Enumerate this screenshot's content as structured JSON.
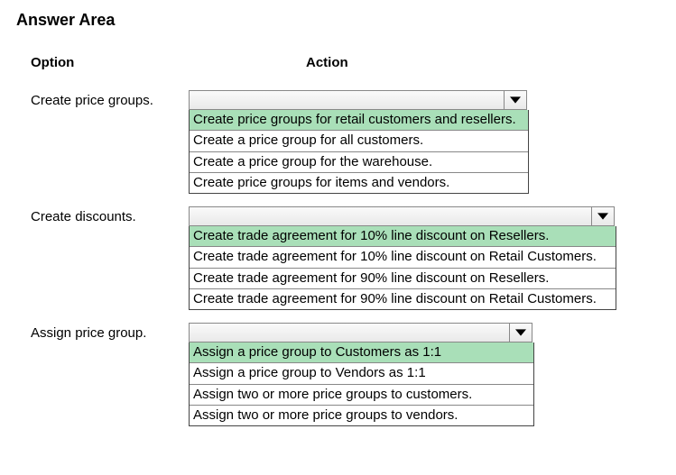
{
  "title": "Answer Area",
  "headers": {
    "option": "Option",
    "action": "Action"
  },
  "rows": [
    {
      "label": "Create price groups.",
      "options": [
        "Create price groups for retail customers and resellers.",
        "Create a price group for all customers.",
        "Create a price group for the warehouse.",
        "Create price groups for items and vendors."
      ],
      "highlighted": 0
    },
    {
      "label": "Create discounts.",
      "options": [
        "Create trade agreement for 10% line discount on Resellers.",
        "Create trade agreement for 10% line discount on Retail Customers.",
        "Create trade agreement for 90% line discount on Resellers.",
        "Create trade agreement for 90% line discount on Retail Customers."
      ],
      "highlighted": 0
    },
    {
      "label": "Assign price group.",
      "options": [
        "Assign a price group to Customers as 1:1",
        "Assign a price group to Vendors as 1:1",
        "Assign two or more price groups to customers.",
        "Assign two or more price groups to vendors."
      ],
      "highlighted": 0
    }
  ]
}
